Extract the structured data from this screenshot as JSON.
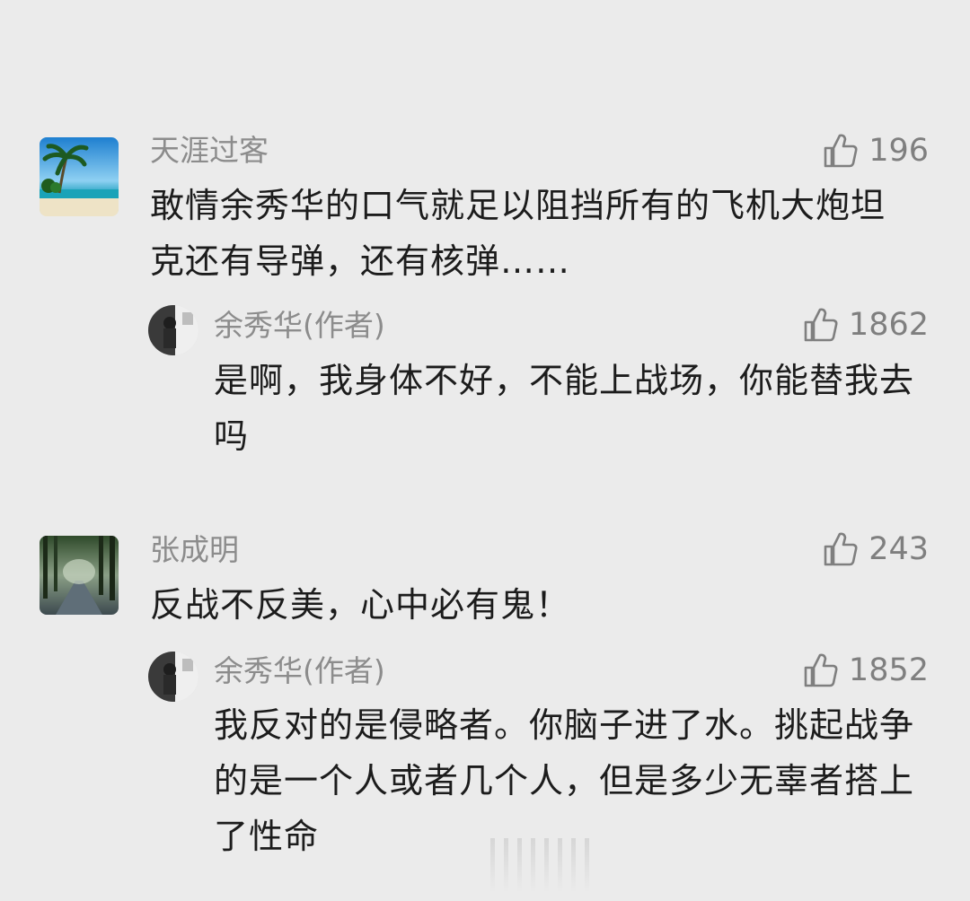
{
  "comments": [
    {
      "user": "天涯过客",
      "likes": "196",
      "text": "敢情余秀华的口气就足以阻挡所有的飞机大炮坦克还有导弹，还有核弹……",
      "reply": {
        "user": "余秀华(作者)",
        "likes": "1862",
        "text": "是啊，我身体不好，不能上战场，你能替我去吗"
      }
    },
    {
      "user": "张成明",
      "likes": "243",
      "text": "反战不反美，心中必有鬼！",
      "reply": {
        "user": "余秀华(作者)",
        "likes": "1852",
        "text": "我反对的是侵略者。你脑子进了水。挑起战争的是一个人或者几个人，但是多少无辜者搭上了性命"
      }
    }
  ],
  "icons": {
    "like": "thumbs-up-icon"
  },
  "colors": {
    "background": "#ebebeb",
    "username": "#8c8c8c",
    "text": "#1c1c1c",
    "like": "#7f7f7f"
  }
}
